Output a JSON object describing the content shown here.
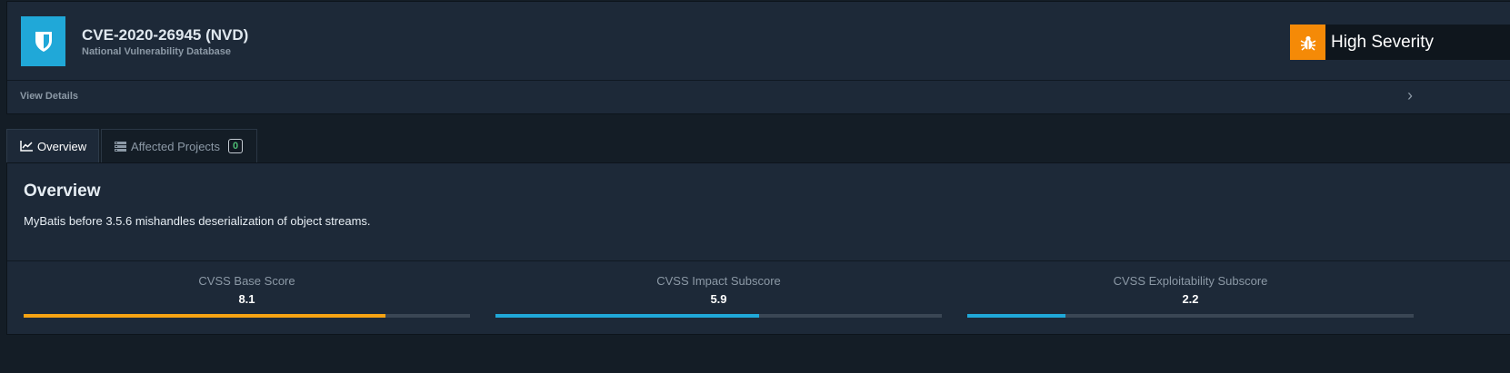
{
  "header": {
    "title": "CVE-2020-26945 (NVD)",
    "subtitle": "National Vulnerability Database",
    "severity": "High Severity",
    "view_details": "View Details"
  },
  "tabs": [
    {
      "label": "Overview",
      "active": true
    },
    {
      "label": "Affected Projects",
      "count": "0",
      "active": false
    }
  ],
  "overview": {
    "title": "Overview",
    "description": "MyBatis before 3.5.6 mishandles deserialization of object streams."
  },
  "scores": [
    {
      "label": "CVSS Base Score",
      "value": "8.1",
      "fill_percent": 81,
      "color": "#f6a313"
    },
    {
      "label": "CVSS Impact Subscore",
      "value": "5.9",
      "fill_percent": 59,
      "color": "#20a8d8"
    },
    {
      "label": "CVSS Exploitability Subscore",
      "value": "2.2",
      "fill_percent": 22,
      "color": "#20a8d8"
    }
  ],
  "colors": {
    "accent": "#20a8d8",
    "severity_high": "#f58a07",
    "badge_count": "#4dbd74"
  },
  "icons": {
    "logo": "shield-icon",
    "severity": "bug-icon",
    "overview_tab": "line-chart-icon",
    "affected_tab": "server-list-icon",
    "details": "chevron-right-icon"
  }
}
